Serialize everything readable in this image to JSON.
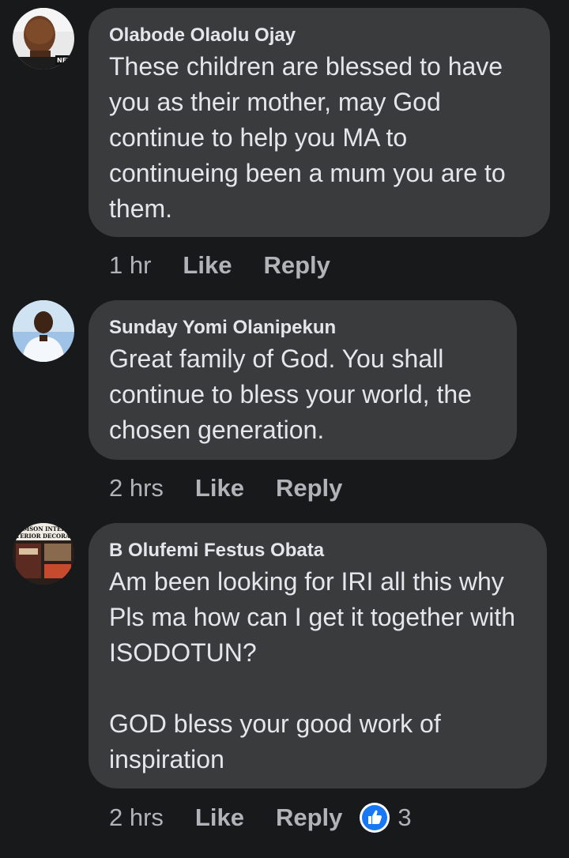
{
  "comments": [
    {
      "author": "Olabode Olaolu Ojay",
      "avatar": "profile-photo",
      "avatar_badge": "NEVS",
      "text": "These children are blessed to have you as their mother, may God continue to help you MA to continueing been a mum you are to them.",
      "time": "1 hr",
      "like_label": "Like",
      "reply_label": "Reply"
    },
    {
      "author": "Sunday Yomi Olanipekun",
      "avatar": "profile-photo",
      "text": "Great family of God. You shall continue to bless your world, the chosen generation.",
      "time": "2 hrs",
      "like_label": "Like",
      "reply_label": "Reply"
    },
    {
      "author": "B Olufemi Festus Obata",
      "avatar": "profile-photo",
      "avatar_caption_1": "EMSON INTER",
      "avatar_caption_2": "TERIOR DECORATI",
      "text": "Am been looking for IRI all this why Pls ma how can I get it together with ISODOTUN?\n\nGOD bless your good work of inspiration",
      "time": "2 hrs",
      "like_label": "Like",
      "reply_label": "Reply",
      "reaction_icon": "thumbs-up-icon",
      "reaction_count": "3"
    }
  ],
  "colors": {
    "background": "#18191a",
    "bubble": "#3a3b3c",
    "primary_text": "#e4e6eb",
    "secondary_text": "#b0b3b8",
    "like_blue": "#1877f2"
  }
}
